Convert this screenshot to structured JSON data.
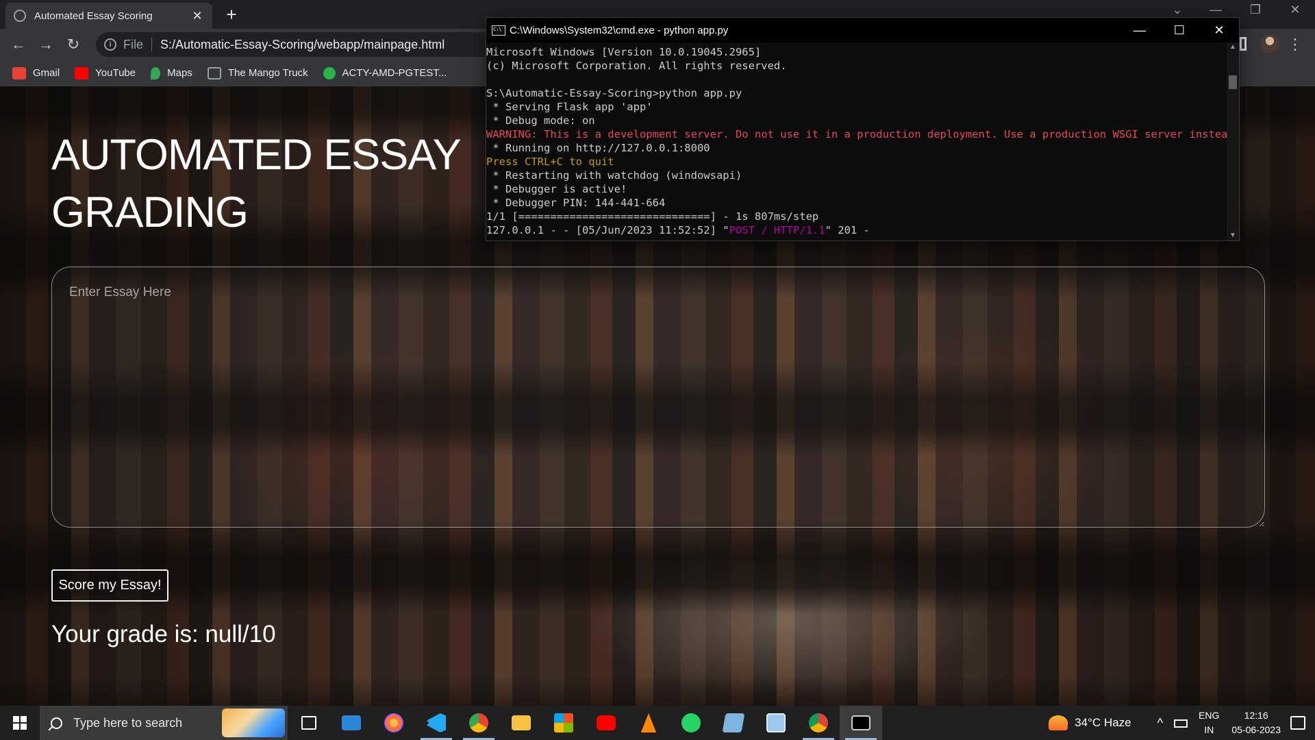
{
  "browser": {
    "tab_title": "Automated Essay Scoring",
    "tab_close": "✕",
    "new_tab": "+",
    "scheme_label": "File",
    "url": "S:/Automatic-Essay-Scoring/webapp/mainpage.html",
    "bookmarks": [
      {
        "label": "Gmail",
        "icon": "gmail-icon",
        "color": "#ea4335"
      },
      {
        "label": "YouTube",
        "icon": "youtube-icon",
        "color": "#ff0000"
      },
      {
        "label": "Maps",
        "icon": "maps-icon",
        "color": "#34a853"
      },
      {
        "label": "The Mango Truck",
        "icon": "cc-icon",
        "color": "#9aa0a6"
      },
      {
        "label": "ACTY-AMD-PGTEST...",
        "icon": "check-icon",
        "color": "#2bb24c"
      }
    ]
  },
  "page": {
    "heading": "AUTOMATED ESSAY GRADING",
    "essay_placeholder": "Enter Essay Here",
    "score_button": "Score my Essay!",
    "grade_text": "Your grade is: null/10"
  },
  "cmd": {
    "title": "C:\\Windows\\System32\\cmd.exe - python  app.py",
    "lines": [
      "Microsoft Windows [Version 10.0.19045.2965]",
      "(c) Microsoft Corporation. All rights reserved.",
      "",
      "S:\\Automatic-Essay-Scoring>python app.py",
      " * Serving Flask app 'app'",
      " * Debug mode: on",
      "WARNING: This is a development server. Do not use it in a production deployment. Use a production WSGI server instead.",
      " * Running on http://127.0.0.1:8000",
      "Press CTRL+C to quit",
      " * Restarting with watchdog (windowsapi)",
      " * Debugger is active!",
      " * Debugger PIN: 144-441-664",
      "1/1 [==============================] - 1s 807ms/step"
    ],
    "last_line_prefix": "127.0.0.1 - - [05/Jun/2023 11:52:52] \"",
    "last_line_request": "POST / HTTP/1.1",
    "last_line_suffix": "\" 201 -"
  },
  "taskbar": {
    "search_placeholder": "Type here to search",
    "apps": [
      {
        "name": "task-view-icon",
        "color": "#ffffff"
      },
      {
        "name": "mail-icon",
        "color": "#2b88d8"
      },
      {
        "name": "firefox-icon",
        "color": "#ff7139"
      },
      {
        "name": "vscode-icon",
        "color": "#23a9f2"
      },
      {
        "name": "chrome-icon",
        "color": "#34a853"
      },
      {
        "name": "file-explorer-icon",
        "color": "#f6c343"
      },
      {
        "name": "microsoft-store-icon",
        "color": "#f25022"
      },
      {
        "name": "youtube-app-icon",
        "color": "#ff0000"
      },
      {
        "name": "vlc-icon",
        "color": "#ff8800"
      },
      {
        "name": "whatsapp-icon",
        "color": "#25d366"
      },
      {
        "name": "notepad-icon",
        "color": "#7fb3e0"
      },
      {
        "name": "paint-icon",
        "color": "#9cc8f0"
      },
      {
        "name": "chrome-profile-icon",
        "color": "#db4437"
      },
      {
        "name": "cmd-icon",
        "color": "#000000"
      }
    ],
    "weather": "34°C  Haze",
    "language": "ENG",
    "region": "IN",
    "time": "12:16",
    "date": "05-06-2023"
  }
}
